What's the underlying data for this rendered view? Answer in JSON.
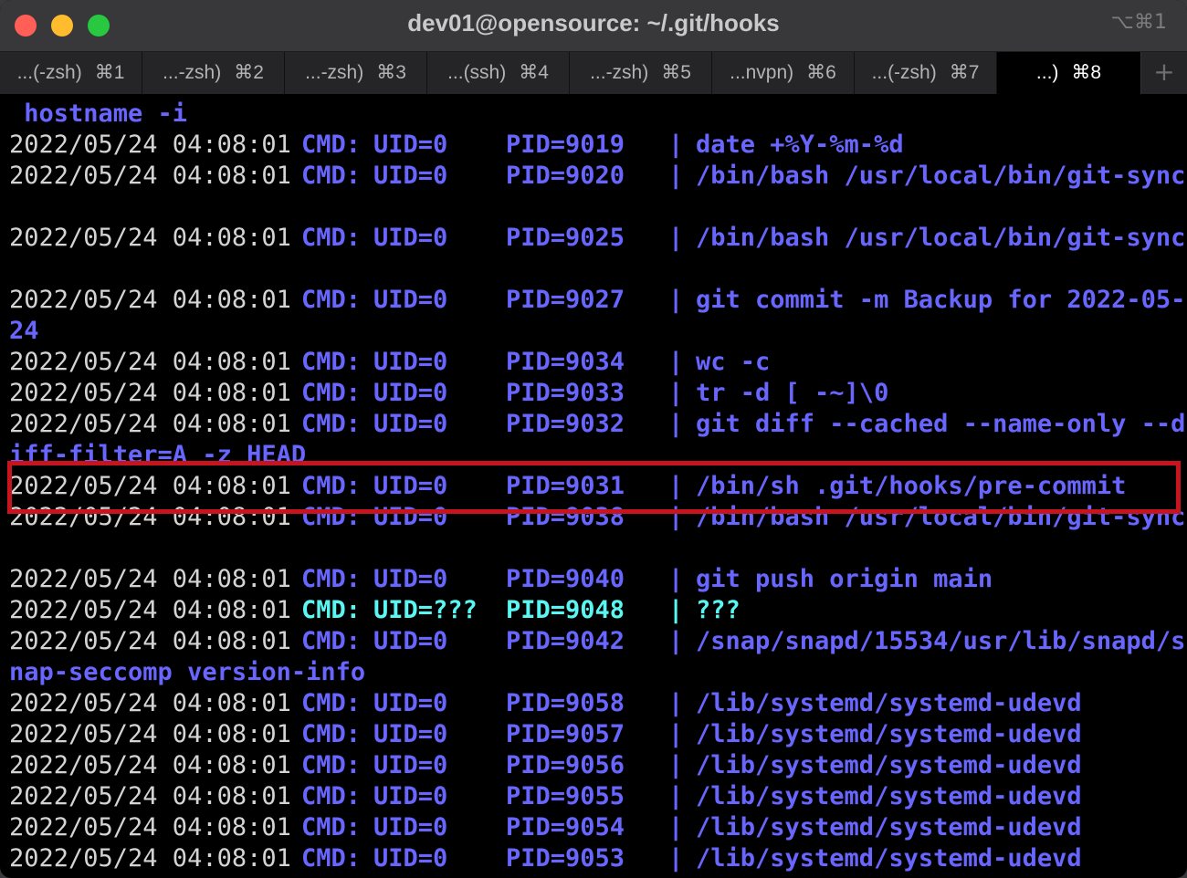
{
  "window": {
    "title": "dev01@opensource: ~/.git/hooks",
    "shortcut": "⌥⌘1"
  },
  "tabs": [
    {
      "label": "...(-zsh)",
      "shortcut": "⌘1"
    },
    {
      "label": "...-zsh)",
      "shortcut": "⌘2"
    },
    {
      "label": "...-zsh)",
      "shortcut": "⌘3"
    },
    {
      "label": "...(ssh)",
      "shortcut": "⌘4"
    },
    {
      "label": "...-zsh)",
      "shortcut": "⌘5"
    },
    {
      "label": "...nvpn)",
      "shortcut": "⌘6"
    },
    {
      "label": "...(-zsh)",
      "shortcut": "⌘7"
    },
    {
      "label": "...)",
      "shortcut": "⌘8"
    }
  ],
  "terminal": {
    "first_line": " hostname -i",
    "rows": [
      {
        "datetime": "2022/05/24 04:08:01",
        "cmd": "CMD:",
        "uid": "UID=0",
        "pid": "PID=9019",
        "sep": "|",
        "command": "date +%Y-%m-%d"
      },
      {
        "datetime": "2022/05/24 04:08:01",
        "cmd": "CMD:",
        "uid": "UID=0",
        "pid": "PID=9020",
        "sep": "|",
        "command": "/bin/bash /usr/local/bin/git-sync"
      },
      {
        "datetime": "2022/05/24 04:08:01",
        "cmd": "CMD:",
        "uid": "UID=0",
        "pid": "PID=9025",
        "sep": "|",
        "command": "/bin/bash /usr/local/bin/git-sync"
      },
      {
        "datetime": "2022/05/24 04:08:01",
        "cmd": "CMD:",
        "uid": "UID=0",
        "pid": "PID=9027",
        "sep": "|",
        "command": "git commit -m Backup for 2022-05-",
        "wrap": "24"
      },
      {
        "datetime": "2022/05/24 04:08:01",
        "cmd": "CMD:",
        "uid": "UID=0",
        "pid": "PID=9034",
        "sep": "|",
        "command": "wc -c"
      },
      {
        "datetime": "2022/05/24 04:08:01",
        "cmd": "CMD:",
        "uid": "UID=0",
        "pid": "PID=9033",
        "sep": "|",
        "command": "tr -d [ -~]\\0"
      },
      {
        "datetime": "2022/05/24 04:08:01",
        "cmd": "CMD:",
        "uid": "UID=0",
        "pid": "PID=9032",
        "sep": "|",
        "command": "git diff --cached --name-only --d",
        "wrap": "iff-filter=A -z HEAD"
      },
      {
        "datetime": "2022/05/24 04:08:01",
        "cmd": "CMD:",
        "uid": "UID=0",
        "pid": "PID=9031",
        "sep": "|",
        "command": "/bin/sh .git/hooks/pre-commit",
        "highlighted": true
      },
      {
        "datetime": "2022/05/24 04:08:01",
        "cmd": "CMD:",
        "uid": "UID=0",
        "pid": "PID=9038",
        "sep": "|",
        "command": "/bin/bash /usr/local/bin/git-sync"
      },
      {
        "datetime": "2022/05/24 04:08:01",
        "cmd": "CMD:",
        "uid": "UID=0",
        "pid": "PID=9040",
        "sep": "|",
        "command": "git push origin main"
      },
      {
        "datetime": "2022/05/24 04:08:01",
        "cmd": "CMD:",
        "uid": "UID=???",
        "pid": "PID=9048",
        "sep": "|",
        "command": "???",
        "unknown": true
      },
      {
        "datetime": "2022/05/24 04:08:01",
        "cmd": "CMD:",
        "uid": "UID=0",
        "pid": "PID=9042",
        "sep": "|",
        "command": "/snap/snapd/15534/usr/lib/snapd/s",
        "wrap": "nap-seccomp version-info"
      },
      {
        "datetime": "2022/05/24 04:08:01",
        "cmd": "CMD:",
        "uid": "UID=0",
        "pid": "PID=9058",
        "sep": "|",
        "command": "/lib/systemd/systemd-udevd"
      },
      {
        "datetime": "2022/05/24 04:08:01",
        "cmd": "CMD:",
        "uid": "UID=0",
        "pid": "PID=9057",
        "sep": "|",
        "command": "/lib/systemd/systemd-udevd"
      },
      {
        "datetime": "2022/05/24 04:08:01",
        "cmd": "CMD:",
        "uid": "UID=0",
        "pid": "PID=9056",
        "sep": "|",
        "command": "/lib/systemd/systemd-udevd"
      },
      {
        "datetime": "2022/05/24 04:08:01",
        "cmd": "CMD:",
        "uid": "UID=0",
        "pid": "PID=9055",
        "sep": "|",
        "command": "/lib/systemd/systemd-udevd"
      },
      {
        "datetime": "2022/05/24 04:08:01",
        "cmd": "CMD:",
        "uid": "UID=0",
        "pid": "PID=9054",
        "sep": "|",
        "command": "/lib/systemd/systemd-udevd"
      },
      {
        "datetime": "2022/05/24 04:08:01",
        "cmd": "CMD:",
        "uid": "UID=0",
        "pid": "PID=9053",
        "sep": "|",
        "command": "/lib/systemd/systemd-udevd"
      }
    ]
  },
  "colors": {
    "highlight_border": "#c8141e",
    "process_text": "#6866ff",
    "unknown_process_text": "#5af7f2",
    "timestamp_text": "#d4d4d4"
  }
}
